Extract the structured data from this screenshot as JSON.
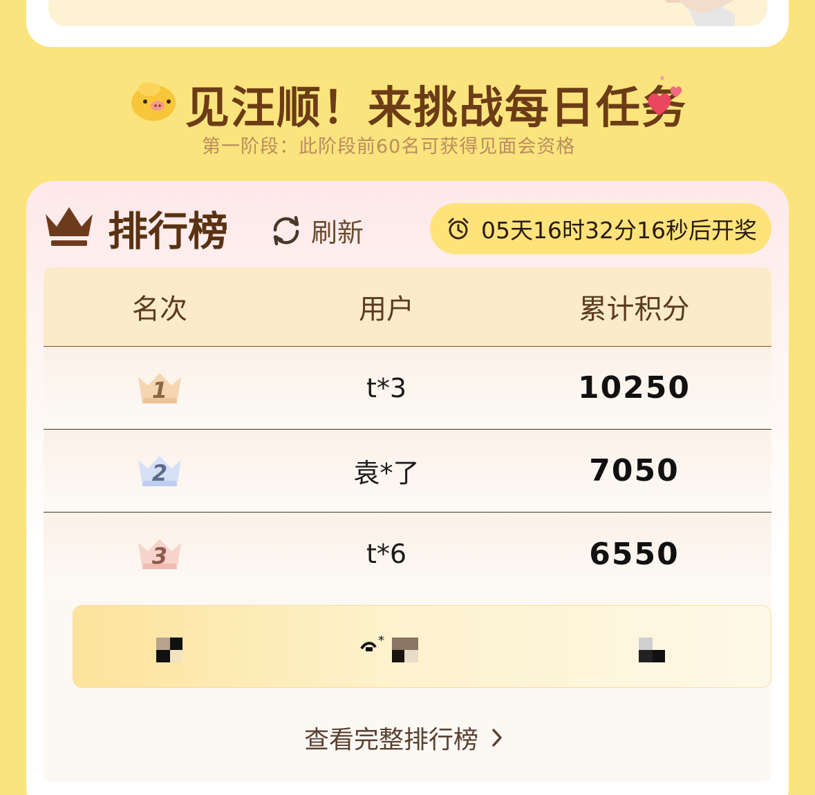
{
  "hero": {
    "title": "见汪顺！来挑战每日任务",
    "subtitle": "第一阶段：此阶段前60名可获得见面会资格"
  },
  "leaderboard": {
    "title": "排行榜",
    "refresh_label": "刷新",
    "countdown": "05天16时32分16秒后开奖",
    "columns": [
      "名次",
      "用户",
      "累计积分"
    ],
    "rows": [
      {
        "rank": "1",
        "user": "t*3",
        "score": "10250"
      },
      {
        "rank": "2",
        "user": "袁*了",
        "score": "7050"
      },
      {
        "rank": "3",
        "user": "t*6",
        "score": "6550"
      }
    ],
    "view_full_label": "查看完整排行榜"
  },
  "colors": {
    "page_bg": "#fbe47d",
    "title_brown": "#6b3c16",
    "countdown_bg": "#fde37a",
    "rank1": "#f2c59a",
    "rank2": "#c4d3f2",
    "rank3": "#f4c4bc"
  },
  "icons": {
    "mascot": "duck-mascot-icon",
    "hearts": "hearts-icon",
    "crown": "crown-icon",
    "refresh": "refresh-icon",
    "alarm": "alarm-clock-icon",
    "chevron": "chevron-right-icon"
  }
}
